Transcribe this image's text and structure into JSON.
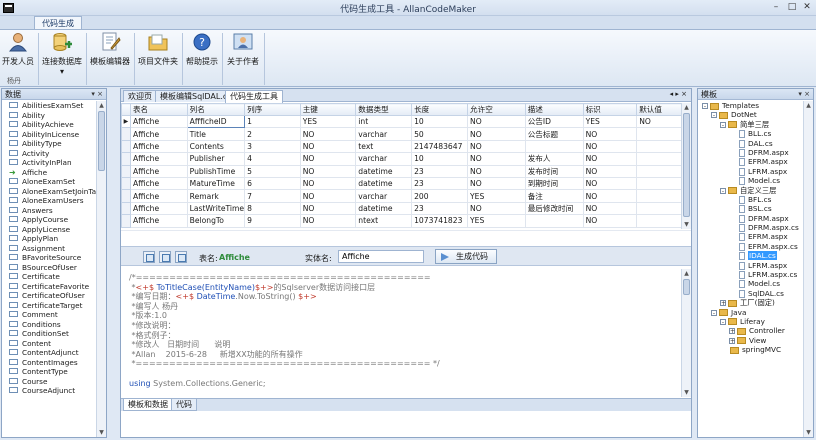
{
  "window": {
    "title": "代码生成工具 - AllanCodeMaker",
    "minimize": "–",
    "maximize": "□",
    "close": "✕"
  },
  "ribbon": {
    "tab": "代码生成",
    "buttons": [
      {
        "label": "开发人员",
        "icon": "developer-icon"
      },
      {
        "label": "连接数据库",
        "icon": "database-connect-icon",
        "dropdown": "▾"
      },
      {
        "label": "模板编辑器",
        "icon": "template-editor-icon"
      },
      {
        "label": "项目文件夹",
        "icon": "folder-icon"
      },
      {
        "label": "帮助提示",
        "icon": "help-icon"
      },
      {
        "label": "关于作者",
        "icon": "about-author-icon"
      }
    ],
    "group_label": "杨丹"
  },
  "left_panel": {
    "title": "数据",
    "pin": "▾ ×",
    "items": [
      "AbilitiesExamSet",
      "Ability",
      "AbilityAchieve",
      "AbilityInLicense",
      "AbilityType",
      "Activity",
      "ActivityInPlan",
      "Affiche",
      "AloneExamSet",
      "AloneExamSetJoinTable",
      "AloneExamUsers",
      "Answers",
      "ApplyCourse",
      "ApplyLicense",
      "ApplyPlan",
      "Assignment",
      "BFavoriteSource",
      "BSourceOfUser",
      "Certificate",
      "CertificateFavorite",
      "CertificateOfUser",
      "CertificateTarget",
      "Comment",
      "Conditions",
      "ConditionSet",
      "Content",
      "ContentAdjunct",
      "ContentImages",
      "ContentType",
      "Course",
      "CourseAdjunct"
    ],
    "selected_index": 7
  },
  "doc_tabs": [
    "欢迎页",
    "模板编辑SqlDAL.cs",
    "代码生成工具"
  ],
  "doc_tab_active": 2,
  "doc_tab_controls": "◂ ▸ ×",
  "grid": {
    "columns": [
      "表名",
      "列名",
      "列序",
      "主键",
      "数据类型",
      "长度",
      "允许空",
      "描述",
      "标识",
      "默认值"
    ],
    "rows": [
      [
        "Affiche",
        "AffficheID",
        "1",
        "YES",
        "int",
        "10",
        "NO",
        "公告ID",
        "YES",
        "NO"
      ],
      [
        "Affiche",
        "Title",
        "2",
        "NO",
        "varchar",
        "50",
        "NO",
        "公告标题",
        "NO",
        ""
      ],
      [
        "Affiche",
        "Contents",
        "3",
        "NO",
        "text",
        "2147483647",
        "NO",
        "",
        "NO",
        ""
      ],
      [
        "Affiche",
        "Publisher",
        "4",
        "NO",
        "varchar",
        "10",
        "NO",
        "发布人",
        "NO",
        ""
      ],
      [
        "Affiche",
        "PublishTime",
        "5",
        "NO",
        "datetime",
        "23",
        "NO",
        "发布时间",
        "NO",
        ""
      ],
      [
        "Affiche",
        "MatureTime",
        "6",
        "NO",
        "datetime",
        "23",
        "NO",
        "到期时间",
        "NO",
        ""
      ],
      [
        "Affiche",
        "Remark",
        "7",
        "NO",
        "varchar",
        "200",
        "YES",
        "备注",
        "NO",
        ""
      ],
      [
        "Affiche",
        "LastWriteTime",
        "8",
        "NO",
        "datetime",
        "23",
        "NO",
        "最后修改时间",
        "NO",
        ""
      ],
      [
        "Affiche",
        "BelongTo",
        "9",
        "NO",
        "ntext",
        "1073741823",
        "YES",
        "",
        "NO",
        ""
      ]
    ]
  },
  "gen_bar": {
    "table_label": "表名:",
    "table_name": "Affiche",
    "entity_label": "实体名:",
    "entity_value": "Affiche",
    "generate": "生成代码"
  },
  "code_lines": [
    [
      [
        "gr",
        "/*============================================"
      ]
    ],
    [
      [
        "gr",
        " *"
      ],
      [
        "kw",
        "<+$ "
      ],
      [
        "bl",
        "ToTitleCase(EntityName)"
      ],
      [
        "kw",
        "$+>"
      ],
      [
        "gr",
        "的Sqlserver数据访问接口层"
      ]
    ],
    [
      [
        "gr",
        " *编写日期："
      ],
      [
        "kw",
        "<+$ "
      ],
      [
        "bl",
        "DateTime"
      ],
      [
        "gr",
        ".Now.ToString() "
      ],
      [
        "kw",
        "$+>"
      ]
    ],
    [
      [
        "gr",
        " *编写人 杨丹"
      ]
    ],
    [
      [
        "gr",
        " *版本:1.0"
      ]
    ],
    [
      [
        "gr",
        " *修改说明："
      ]
    ],
    [
      [
        "gr",
        " *格式例子："
      ]
    ],
    [
      [
        "gr",
        " *修改人   日期时间      说明"
      ]
    ],
    [
      [
        "gr",
        " *Allan    2015-6-28     新增XX功能的所有操作"
      ]
    ],
    [
      [
        "gr",
        " *============================================ */"
      ]
    ],
    [
      [
        "gr",
        ""
      ]
    ],
    [
      [
        "bl",
        "using"
      ],
      [
        "gr",
        " System.Collections.Generic;"
      ]
    ]
  ],
  "bottom_tabs": [
    "模板和数据",
    "代码"
  ],
  "right_panel": {
    "title": "模板",
    "pin": "▾ ×",
    "tree": [
      {
        "level": 0,
        "type": "folder",
        "label": "Templates",
        "exp": "-"
      },
      {
        "level": 1,
        "type": "folder",
        "label": "DotNet",
        "exp": "-"
      },
      {
        "level": 2,
        "type": "folder",
        "label": "简单三层",
        "exp": "-"
      },
      {
        "level": 3,
        "type": "file",
        "label": "BLL.cs"
      },
      {
        "level": 3,
        "type": "file",
        "label": "DAL.cs"
      },
      {
        "level": 3,
        "type": "file",
        "label": "DFRM.aspx"
      },
      {
        "level": 3,
        "type": "file",
        "label": "EFRM.aspx"
      },
      {
        "level": 3,
        "type": "file",
        "label": "LFRM.aspx"
      },
      {
        "level": 3,
        "type": "file",
        "label": "Model.cs"
      },
      {
        "level": 2,
        "type": "folder",
        "label": "自定义三层",
        "exp": "-"
      },
      {
        "level": 3,
        "type": "file",
        "label": "BFL.cs"
      },
      {
        "level": 3,
        "type": "file",
        "label": "BSL.cs"
      },
      {
        "level": 3,
        "type": "file",
        "label": "DFRM.aspx"
      },
      {
        "level": 3,
        "type": "file",
        "label": "DFRM.aspx.cs"
      },
      {
        "level": 3,
        "type": "file",
        "label": "EFRM.aspx"
      },
      {
        "level": 3,
        "type": "file",
        "label": "EFRM.aspx.cs"
      },
      {
        "level": 3,
        "type": "file",
        "label": "IDAL.cs",
        "selected": true
      },
      {
        "level": 3,
        "type": "file",
        "label": "LFRM.aspx"
      },
      {
        "level": 3,
        "type": "file",
        "label": "LFRM.aspx.cs"
      },
      {
        "level": 3,
        "type": "file",
        "label": "Model.cs"
      },
      {
        "level": 3,
        "type": "file",
        "label": "SqlDAL.cs"
      },
      {
        "level": 2,
        "type": "folder",
        "label": "工厂(固定)",
        "exp": "+"
      },
      {
        "level": 1,
        "type": "folder",
        "label": "Java",
        "exp": "-"
      },
      {
        "level": 2,
        "type": "folder",
        "label": "Liferay",
        "exp": "-"
      },
      {
        "level": 3,
        "type": "folder",
        "label": "Controller",
        "exp": "+"
      },
      {
        "level": 3,
        "type": "folder",
        "label": "View",
        "exp": "+"
      },
      {
        "level": 2,
        "type": "folder",
        "label": "springMVC"
      }
    ]
  },
  "colors": {
    "accent": "#3399ff",
    "chrome": "#dfe8f4",
    "border": "#8ea6c6"
  }
}
